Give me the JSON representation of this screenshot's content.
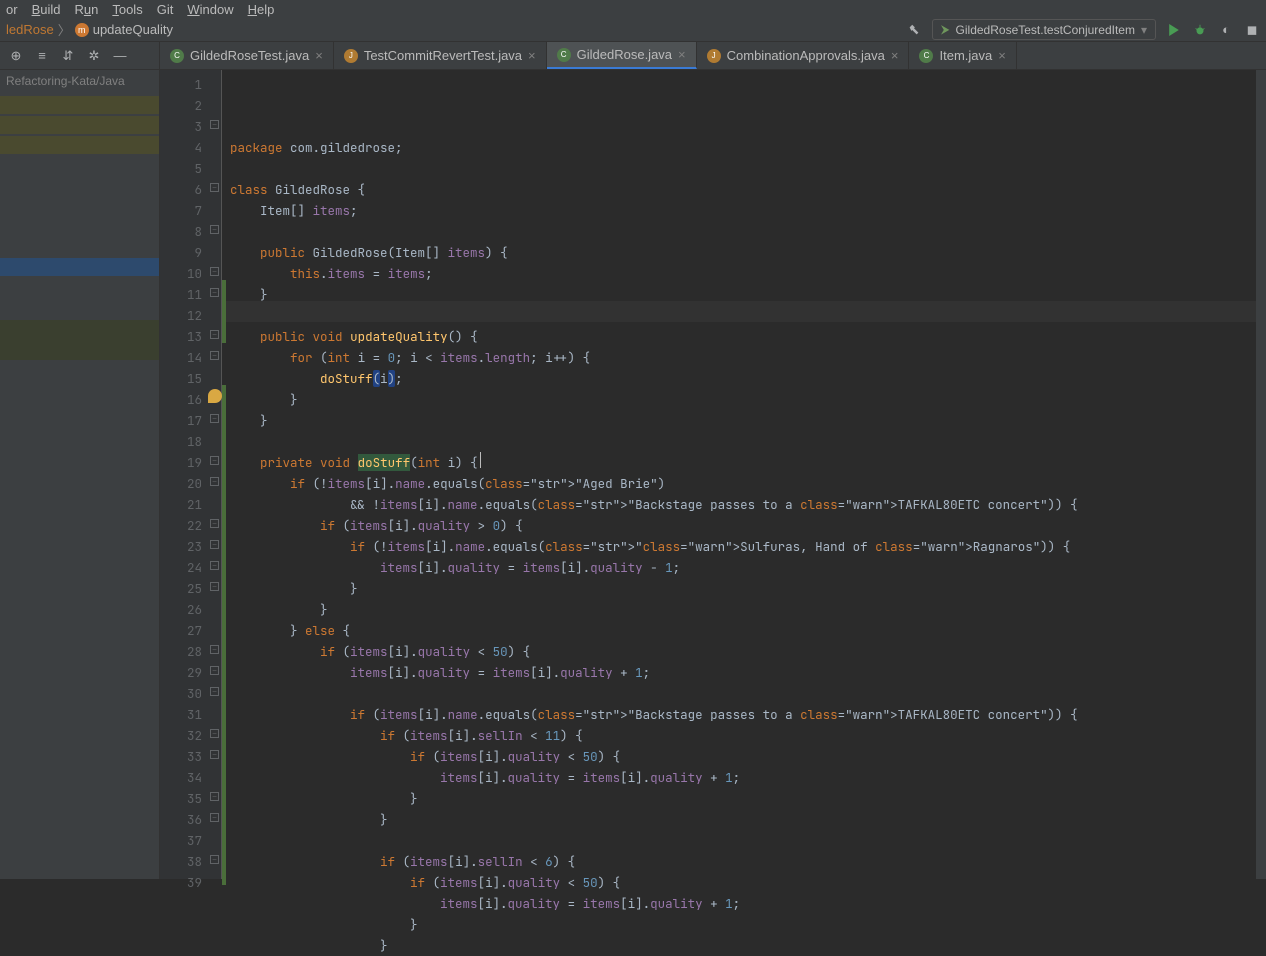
{
  "menu": {
    "build": "Build",
    "run": "Run",
    "tools": "Tools",
    "git": "Git",
    "window": "Window",
    "help": "Help",
    "or": "or"
  },
  "breadcrumbs": {
    "class": "ledRose",
    "method": "updateQuality",
    "sep": "〉"
  },
  "run_config": "GildedRoseTest.testConjuredItem",
  "sidebar": {
    "title": "Refactoring-Kata/Java"
  },
  "tabs": [
    {
      "label": "GildedRoseTest.java",
      "active": false
    },
    {
      "label": "TestCommitRevertTest.java",
      "active": false,
      "kt": true
    },
    {
      "label": "GildedRose.java",
      "active": true
    },
    {
      "label": "CombinationApprovals.java",
      "active": false,
      "kt": true
    },
    {
      "label": "Item.java",
      "active": false
    }
  ],
  "code": {
    "lines": [
      "package com.gildedrose;",
      "",
      "class GildedRose {",
      "    Item[] items;",
      "",
      "    public GildedRose(Item[] items) {",
      "        this.items = items;",
      "    }",
      "",
      "    public void updateQuality() {",
      "        for (int i = 0; i < items.length; i++) {",
      "            doStuff(i);",
      "        }",
      "    }",
      "",
      "    private void doStuff(int i) {",
      "        if (!items[i].name.equals(\"Aged Brie\")",
      "                && !items[i].name.equals(\"Backstage passes to a TAFKAL80ETC concert\")) {",
      "            if (items[i].quality > 0) {",
      "                if (!items[i].name.equals(\"Sulfuras, Hand of Ragnaros\")) {",
      "                    items[i].quality = items[i].quality - 1;",
      "                }",
      "            }",
      "        } else {",
      "            if (items[i].quality < 50) {",
      "                items[i].quality = items[i].quality + 1;",
      "",
      "                if (items[i].name.equals(\"Backstage passes to a TAFKAL80ETC concert\")) {",
      "                    if (items[i].sellIn < 11) {",
      "                        if (items[i].quality < 50) {",
      "                            items[i].quality = items[i].quality + 1;",
      "                        }",
      "                    }",
      "",
      "                    if (items[i].sellIn < 6) {",
      "                        if (items[i].quality < 50) {",
      "                            items[i].quality = items[i].quality + 1;",
      "                        }",
      "                    }"
    ],
    "start_line": 1
  },
  "chart_data": null
}
